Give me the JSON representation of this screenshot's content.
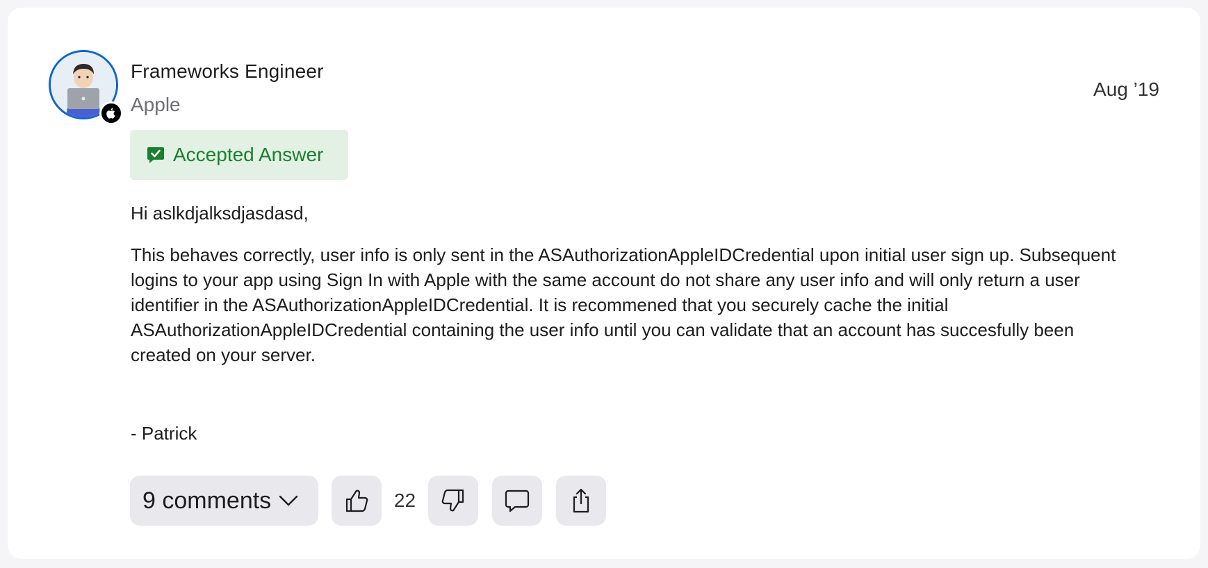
{
  "post": {
    "author_name": "Frameworks Engineer",
    "author_company": "Apple",
    "date": "Aug ’19",
    "accepted_label": "Accepted Answer",
    "greeting": "Hi aslkdjalksdjasdasd,",
    "body": "This behaves correctly, user info is only sent in the ASAuthorizationAppleIDCredential upon initial user sign up. Subsequent logins to your app using Sign In with Apple with the same account do not share any user info and will only return a user identifier in the ASAuthorizationAppleIDCredential. It is recommened that you securely cache the initial ASAuthorizationAppleIDCredential containing the user info until you can validate that an account has succesfully been created on your server.",
    "signature": "- Patrick"
  },
  "actions": {
    "comments_label": "9 comments",
    "upvote_count": "22"
  },
  "icons": {
    "avatar": "memoji-avatar",
    "badge": "apple-logo-icon",
    "accepted": "checkmark-bubble-icon",
    "comments_chevron": "chevron-down-icon",
    "upvote": "thumbs-up-icon",
    "downvote": "thumbs-down-icon",
    "reply": "speech-bubble-icon",
    "share": "share-icon"
  },
  "colors": {
    "avatar_ring": "#0f66cf",
    "accepted_bg": "#e2f1e4",
    "accepted_text": "#1a7f2e",
    "button_bg": "#e8e8ed"
  }
}
